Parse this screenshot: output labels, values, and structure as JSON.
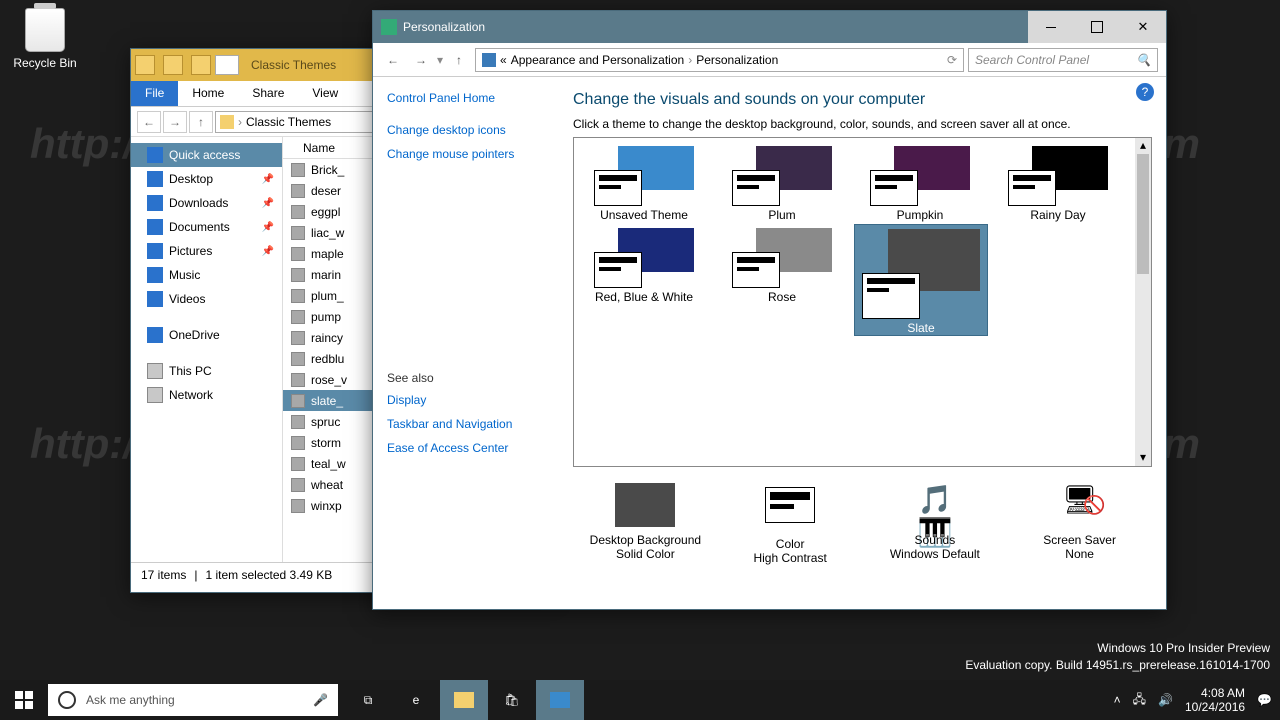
{
  "desktop": {
    "recycle_label": "Recycle Bin",
    "info_line1": "Windows 10 Pro Insider Preview",
    "info_line2": "Evaluation copy. Build 14951.rs_prerelease.161014-1700"
  },
  "explorer": {
    "title": "Classic Themes",
    "tabs": {
      "file": "File",
      "home": "Home",
      "share": "Share",
      "view": "View"
    },
    "breadcrumb": "Classic Themes",
    "list_header": "Name",
    "sidebar": [
      {
        "label": "Quick access",
        "sel": true,
        "icon": "ic-blue"
      },
      {
        "label": "Desktop",
        "icon": "ic-blue",
        "pin": true
      },
      {
        "label": "Downloads",
        "icon": "ic-blue",
        "pin": true
      },
      {
        "label": "Documents",
        "icon": "ic-blue",
        "pin": true
      },
      {
        "label": "Pictures",
        "icon": "ic-blue",
        "pin": true
      },
      {
        "label": "Music",
        "icon": "ic-blue"
      },
      {
        "label": "Videos",
        "icon": "ic-blue"
      },
      {
        "label": "OneDrive",
        "icon": "ic-blue"
      },
      {
        "label": "This PC",
        "icon": "ic-drive"
      },
      {
        "label": "Network",
        "icon": "ic-drive"
      }
    ],
    "files": [
      "Brick_",
      "deser",
      "eggpl",
      "liac_w",
      "maple",
      "marin",
      "plum_",
      "pump",
      "raincy",
      "redblu",
      "rose_v",
      "slate_",
      "spruc",
      "storm",
      "teal_w",
      "wheat",
      "winxp"
    ],
    "selected_file_index": 11,
    "status_items": "17 items",
    "status_sel": "1 item selected  3.49 KB"
  },
  "perso": {
    "title": "Personalization",
    "crumbs": {
      "p1": "Appearance and Personalization",
      "p2": "Personalization"
    },
    "search_placeholder": "Search Control Panel",
    "left": {
      "home": "Control Panel Home",
      "link1": "Change desktop icons",
      "link2": "Change mouse pointers",
      "seealso": "See also",
      "link3": "Display",
      "link4": "Taskbar and Navigation",
      "link5": "Ease of Access Center"
    },
    "heading": "Change the visuals and sounds on your computer",
    "hint": "Click a theme to change the desktop background, color, sounds, and screen saver all at once.",
    "themes": [
      {
        "name": "Unsaved Theme",
        "bg": "#3a8acc"
      },
      {
        "name": "Plum",
        "bg": "#3a2a4a"
      },
      {
        "name": "Pumpkin",
        "bg": "#4a1a4a"
      },
      {
        "name": "Rainy Day",
        "bg": "#000000"
      },
      {
        "name": "Red, Blue & White",
        "bg": "#1a2a7a"
      },
      {
        "name": "Rose",
        "bg": "#8a8a8a"
      },
      {
        "name": "Slate",
        "bg": "#4a4a4a",
        "sel": true
      }
    ],
    "bottom": [
      {
        "title": "Desktop Background",
        "sub": "Solid Color"
      },
      {
        "title": "Color",
        "sub": "High Contrast"
      },
      {
        "title": "Sounds",
        "sub": "Windows Default"
      },
      {
        "title": "Screen Saver",
        "sub": "None"
      }
    ]
  },
  "taskbar": {
    "search_placeholder": "Ask me anything",
    "time": "4:08 AM",
    "date": "10/24/2016"
  }
}
